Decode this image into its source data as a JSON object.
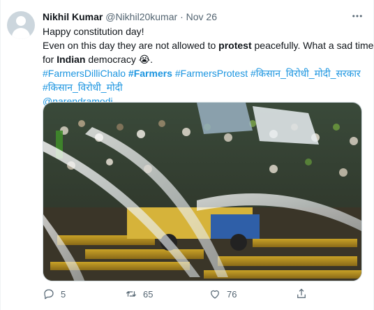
{
  "author": {
    "name": "Nikhil Kumar",
    "handle": "@Nikhil20kumar",
    "separator": "·",
    "date": "Nov 26"
  },
  "tweet": {
    "line1": "Happy constitution day!",
    "line2_pre": "Even on this day they are not allowed to ",
    "line2_bold": "protest",
    "line2_post": " peacefully. What a sad time",
    "line3_pre": "for ",
    "line3_bold": "Indian",
    "line3_post": " democracy",
    "emoji": "😭",
    "line3_end": ".",
    "hashtags": {
      "h1": "#FarmersDilliChalo",
      "h2": "#Farmers",
      "h3": "#FarmersProtest",
      "h4": "#किसान_विरोधी_मोदी_सरकार",
      "h5": "#किसान_विरोधी_मोदी"
    },
    "mention": "@narendramodi"
  },
  "actions": {
    "replies": "5",
    "retweets": "65",
    "likes": "76"
  },
  "colors": {
    "link": "#1b95e0",
    "text": "#0f1419",
    "muted": "#536471"
  },
  "icons": {
    "more": "more-icon",
    "reply": "reply-icon",
    "retweet": "retweet-icon",
    "like": "like-icon",
    "share": "share-icon"
  }
}
